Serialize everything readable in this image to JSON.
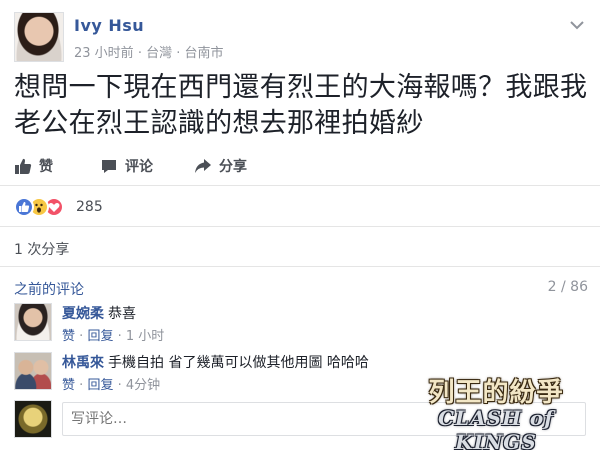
{
  "post": {
    "author": "Ivy Hsu",
    "time": "23 小时前",
    "separator": "·",
    "location_1": "台灣",
    "location_2": "台南市",
    "text": "想問一下現在西門還有烈王的大海報嗎？我跟我老公在烈王認識的想去那裡拍婚紗"
  },
  "actions": {
    "like": "赞",
    "comment": "评论",
    "share": "分享"
  },
  "reactions": {
    "count": "285",
    "icons": [
      "like-icon",
      "wow-icon",
      "love-icon"
    ],
    "colors": {
      "like": "#4a76d6",
      "wow": "#f7c744",
      "love": "#f25268"
    }
  },
  "shares": {
    "text": "1 次分享"
  },
  "comments_header": {
    "previous_label": "之前的评论",
    "count": "2 / 86"
  },
  "comments": [
    {
      "name": "夏婉柔",
      "text": "恭喜",
      "like": "赞",
      "dot": "·",
      "reply": "回复",
      "time": "1 小时"
    },
    {
      "name": "林禹來",
      "text": "手機自拍 省了幾萬可以做其他用圖 哈哈哈",
      "like": "赞",
      "dot": "·",
      "reply": "回复",
      "time": "4分钟"
    }
  ],
  "write_comment": {
    "placeholder": "写评论…"
  },
  "watermark": {
    "line1": "列王的紛爭",
    "line2": "CLASH of KINGS"
  },
  "colors": {
    "link": "#365899",
    "meta": "#90949c",
    "text": "#1d2129"
  }
}
